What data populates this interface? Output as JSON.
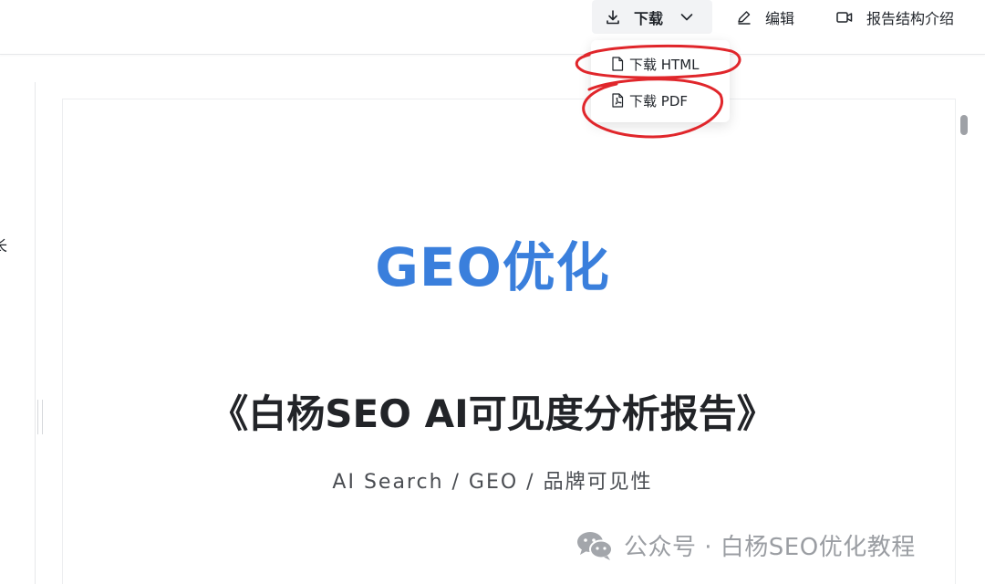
{
  "toolbar": {
    "download_label": "下载",
    "edit_label": "编辑",
    "report_structure_label": "报告结构介绍"
  },
  "download_menu": {
    "items": [
      {
        "label": "下载 HTML",
        "icon": "file-icon"
      },
      {
        "label": "下载 PDF",
        "icon": "pdf-file-icon"
      }
    ]
  },
  "sidebar": {
    "cut_text": "长"
  },
  "document": {
    "title": "GEO优化",
    "heading": "《白杨SEO AI可见度分析报告》",
    "subtitle": "AI Search / GEO / 品牌可见性"
  },
  "watermark": {
    "text": "公众号 · 白杨SEO优化教程",
    "icon": "wechat-icon"
  },
  "colors": {
    "title_blue": "#3a7fdc",
    "annotation_red": "#e0262b",
    "watermark_gray": "#9b9ea3"
  }
}
